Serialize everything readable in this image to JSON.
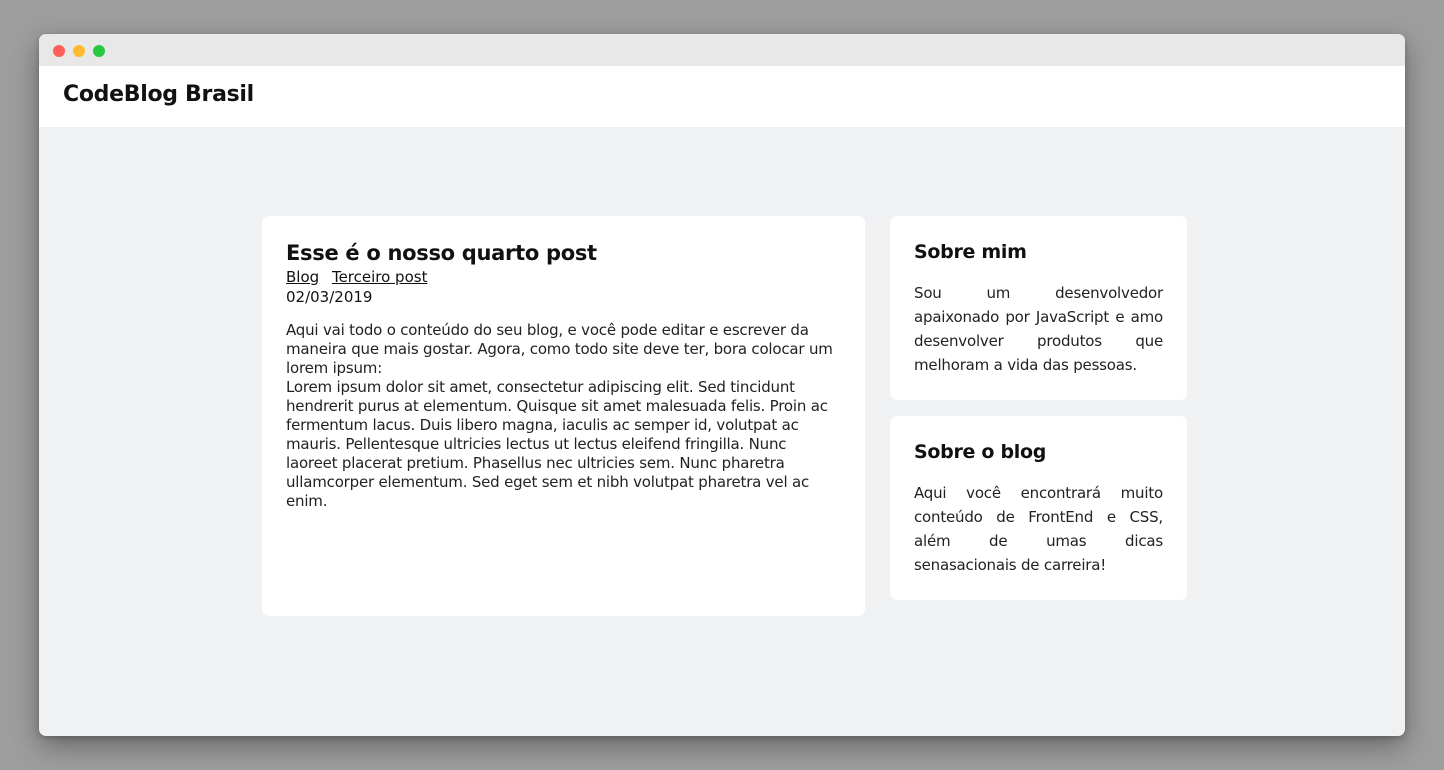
{
  "brand": "CodeBlog Brasil",
  "post": {
    "title": "Esse é o nosso quarto post",
    "tags": [
      "Blog",
      "Terceiro post"
    ],
    "date": "02/03/2019",
    "body_intro": "Aqui vai todo o conteúdo do seu blog, e você pode editar e escrever da maneira que mais gostar. Agora, como todo site deve ter, bora colocar um lorem ipsum:",
    "body_lorem": "Lorem ipsum dolor sit amet, consectetur adipiscing elit. Sed tincidunt hendrerit purus at elementum. Quisque sit amet malesuada felis. Proin ac fermentum lacus. Duis libero magna, iaculis ac semper id, volutpat ac mauris. Pellentesque ultricies lectus ut lectus eleifend fringilla. Nunc laoreet placerat pretium. Phasellus nec ultricies sem. Nunc pharetra ullamcorper elementum. Sed eget sem et nibh volutpat pharetra vel ac enim."
  },
  "sidebar": {
    "about": {
      "title": "Sobre mim",
      "text": "Sou um desenvolvedor apaixonado por JavaScript e amo desenvolver produtos que melhoram a vida das pessoas."
    },
    "blog": {
      "title": "Sobre o blog",
      "text": "Aqui você encontrará muito conteúdo de FrontEnd e CSS, além de umas dicas senasacionais de carreira!"
    }
  }
}
